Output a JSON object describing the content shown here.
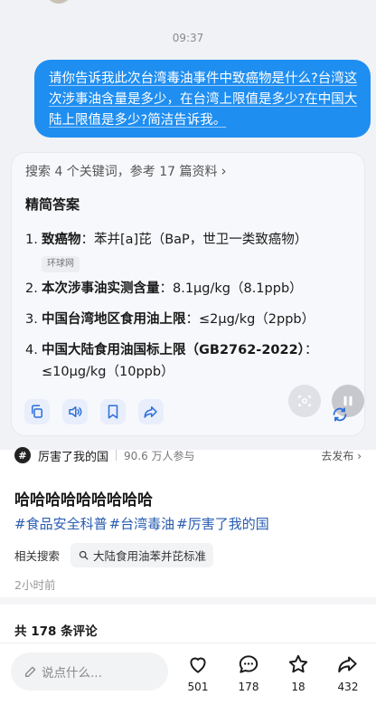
{
  "status": {
    "time": "09:37"
  },
  "user_message": {
    "text": "请你告诉我此次台湾毒油事件中致癌物是什么?台湾这次涉事油含量是多少，在台湾上限值是多少?在中国大陆上限值是多少?简洁告诉我。"
  },
  "answer": {
    "search_info": "搜索 4 个关键词，参考 17 篇资料",
    "title": "精简答案",
    "items": [
      {
        "num": "1.",
        "label": "致癌物",
        "text": "：苯并[a]芘（BaP，世卫一类致癌物）",
        "source": "环球网"
      },
      {
        "num": "2.",
        "label": "本次涉事油实测含量",
        "text": "：8.1μg/kg（8.1ppb）"
      },
      {
        "num": "3.",
        "label": "中国台湾地区食用油上限",
        "text": "：≤2μg/kg（2ppb）"
      },
      {
        "num": "4.",
        "label": "中国大陆食用油国标上限（GB2762-2022）",
        "text": "：≤10μg/kg（10ppb）"
      }
    ]
  },
  "topic": {
    "badge": "#",
    "name": "厉害了我的国",
    "participants": "90.6 万人参与",
    "action": "去发布 ›"
  },
  "post": {
    "title": "哈哈哈哈哈哈哈哈哈",
    "hashtags": [
      "#食品安全科普",
      "#台湾毒油",
      "#厉害了我的国"
    ],
    "related_label": "相关搜索",
    "related_query": "大陆食用油苯并芘标准",
    "time": "2小时前"
  },
  "comments": {
    "total": "共 178 条评论"
  },
  "bottom_bar": {
    "input_placeholder": "说点什么...",
    "likes": "501",
    "comments": "178",
    "favorites": "18",
    "shares": "432"
  },
  "colors": {
    "accent": "#1f8ef1",
    "hashtag": "#2a5db0"
  }
}
